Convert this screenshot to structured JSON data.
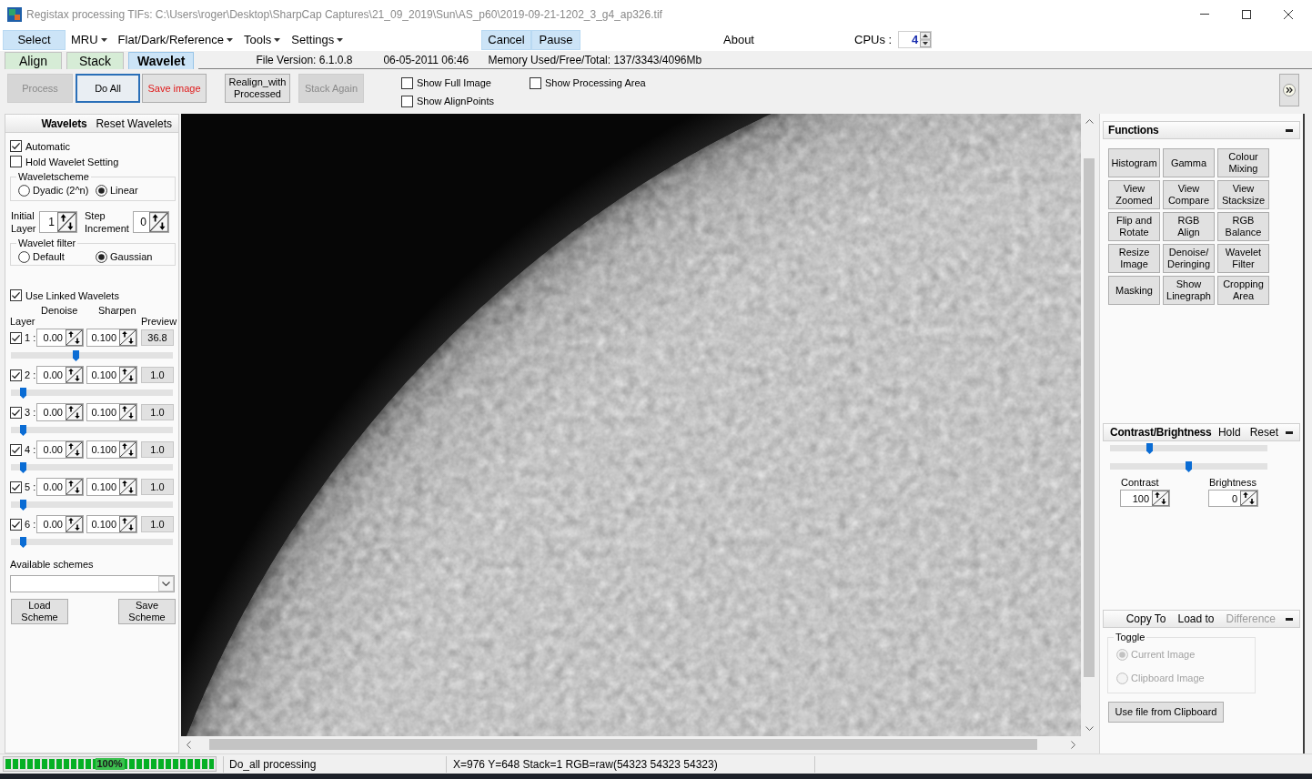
{
  "window": {
    "title": "Registax processing TIFs: C:\\Users\\roger\\Desktop\\SharpCap Captures\\21_09_2019\\Sun\\AS_p60\\2019-09-21-1202_3_g4_ap326.tif"
  },
  "menu_bar": {
    "select": "Select",
    "menus": [
      "MRU",
      "Flat/Dark/Reference",
      "Tools",
      "Settings"
    ],
    "run_buttons": [
      "Cancel",
      "Pause"
    ],
    "about": "About",
    "cpus": {
      "label": "CPUs :",
      "value": "4"
    }
  },
  "tabs": [
    {
      "label": "Align",
      "selected": false
    },
    {
      "label": "Stack",
      "selected": false
    },
    {
      "label": "Wavelet",
      "selected": true
    }
  ],
  "info": [
    "File Version: 6.1.0.8",
    "06-05-2011 06:46",
    "Memory Used/Free/Total: 137/3343/4096Mb"
  ],
  "toolbar": {
    "buttons": [
      {
        "label": "Process",
        "kind": "normal",
        "disabled": true,
        "focused": false
      },
      {
        "label": "Do All",
        "kind": "normal",
        "disabled": false,
        "focused": true
      },
      {
        "label": "Save image",
        "kind": "alert",
        "disabled": false,
        "focused": false
      },
      {
        "label": "Realign_with Processed",
        "kind": "normal",
        "disabled": false,
        "focused": false
      },
      {
        "label": "Stack Again",
        "kind": "normal",
        "disabled": true,
        "focused": false
      }
    ],
    "checkboxes": [
      {
        "label": "Show Full Image",
        "checked": false
      },
      {
        "label": "Show AlignPoints",
        "checked": false
      },
      {
        "label": "Show Processing Area",
        "checked": false
      }
    ]
  },
  "wavelets": {
    "title": "Wavelets",
    "reset": "Reset Wavelets",
    "options": [
      {
        "label": "Automatic",
        "checked": true
      },
      {
        "label": "Hold Wavelet Setting",
        "checked": false
      }
    ],
    "scheme": {
      "legend": "Waveletscheme",
      "options": [
        {
          "label": "Dyadic (2^n)",
          "selected": false
        },
        {
          "label": "Linear",
          "selected": true
        }
      ]
    },
    "initial_layer": {
      "label": "Initial Layer",
      "value": "1"
    },
    "step_increment": {
      "label": "Step Increment",
      "value": "0"
    },
    "filter": {
      "legend": "Wavelet filter",
      "options": [
        {
          "label": "Default",
          "selected": false
        },
        {
          "label": "Gaussian",
          "selected": true
        }
      ]
    },
    "linked": {
      "label": "Use Linked Wavelets",
      "checked": true
    },
    "headings": {
      "denoise": "Denoise",
      "sharpen": "Sharpen",
      "layer": "Layer",
      "preview": "Preview"
    },
    "layers": [
      {
        "enabled": true,
        "number": "1 :",
        "denoise": "0.00",
        "sharpen": "0.100",
        "preview": "36.8",
        "level": 0.4
      },
      {
        "enabled": true,
        "number": "2 :",
        "denoise": "0.00",
        "sharpen": "0.100",
        "preview": "1.0",
        "level": 0.06
      },
      {
        "enabled": true,
        "number": "3 :",
        "denoise": "0.00",
        "sharpen": "0.100",
        "preview": "1.0",
        "level": 0.06
      },
      {
        "enabled": true,
        "number": "4 :",
        "denoise": "0.00",
        "sharpen": "0.100",
        "preview": "1.0",
        "level": 0.06
      },
      {
        "enabled": true,
        "number": "5 :",
        "denoise": "0.00",
        "sharpen": "0.100",
        "preview": "1.0",
        "level": 0.06
      },
      {
        "enabled": true,
        "number": "6 :",
        "denoise": "0.00",
        "sharpen": "0.100",
        "preview": "1.0",
        "level": 0.06
      }
    ],
    "schemes_label": "Available schemes",
    "scheme_buttons": [
      "Load Scheme",
      "Save Scheme"
    ]
  },
  "functions": {
    "title": "Functions",
    "buttons": [
      "Histogram",
      "View Zoomed",
      "Flip and Rotate",
      "Resize Image",
      "Masking",
      "Gamma",
      "View Compare",
      "RGB Align",
      "Denoise/ Deringing",
      "Show Linegraph",
      "Colour Mixing",
      "View Stacksize",
      "RGB Balance",
      "Wavelet Filter",
      "Cropping Area"
    ]
  },
  "contrast_brightness": {
    "title": "Contrast/Brightness",
    "actions": [
      "Hold",
      "Reset"
    ],
    "sliders": [
      {
        "level": 0.24
      },
      {
        "level": 0.5
      }
    ],
    "fields": [
      {
        "label": "Contrast",
        "value": "100"
      },
      {
        "label": "Brightness",
        "value": "0"
      }
    ]
  },
  "compare": {
    "actions": [
      {
        "label": "Copy To",
        "disabled": false
      },
      {
        "label": "Load to",
        "disabled": false
      },
      {
        "label": "Difference",
        "disabled": true
      }
    ],
    "toggle": {
      "legend": "Toggle",
      "disabled": true,
      "options": [
        {
          "label": "Current Image",
          "selected": true
        },
        {
          "label": "Clipboard Image",
          "selected": false
        }
      ]
    },
    "button": "Use file from Clipboard"
  },
  "status_bar": {
    "progress": {
      "label": "100%",
      "level": 1
    },
    "message": "Do_all processing",
    "readout": "X=976 Y=648 Stack=1 RGB=raw(54323 54323 54323)"
  }
}
